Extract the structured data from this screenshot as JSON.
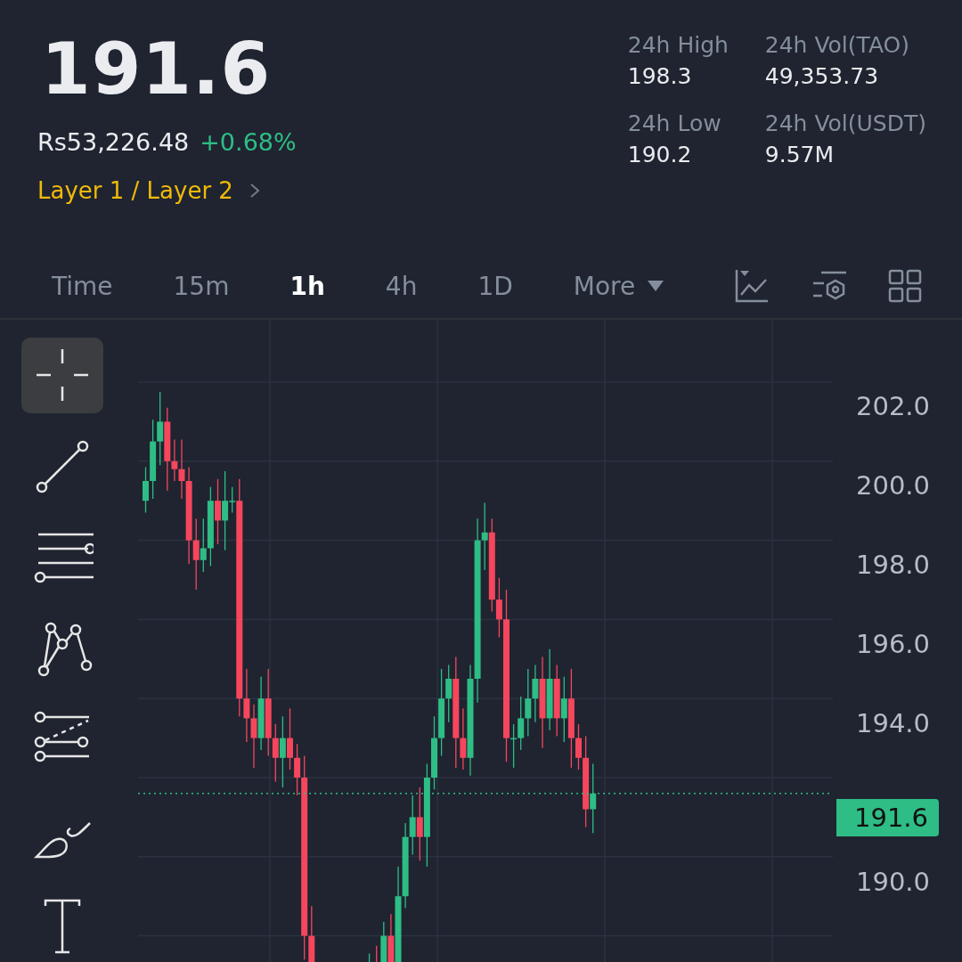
{
  "ticker": {
    "last_price": "191.6",
    "fiat_price": "Rs53,226.48",
    "change": "+0.68%",
    "category": "Layer 1 / Layer 2"
  },
  "stats": [
    {
      "label": "24h High",
      "value": "198.3"
    },
    {
      "label": "24h Vol(TAO)",
      "value": "49,353.73"
    },
    {
      "label": "24h Low",
      "value": "190.2"
    },
    {
      "label": "24h Vol(USDT)",
      "value": "9.57M"
    }
  ],
  "intervals": [
    {
      "label": "Time",
      "selected": false
    },
    {
      "label": "15m",
      "selected": false
    },
    {
      "label": "1h",
      "selected": true
    },
    {
      "label": "4h",
      "selected": false
    },
    {
      "label": "1D",
      "selected": false
    },
    {
      "label": "More",
      "selected": false,
      "dropdown": true
    }
  ],
  "toolbar_icons": [
    {
      "kind": "indicators"
    },
    {
      "kind": "settings"
    },
    {
      "kind": "layout"
    }
  ],
  "drawing_tools": [
    {
      "kind": "crosshair",
      "selected": true
    },
    {
      "kind": "trend-line",
      "selected": false
    },
    {
      "kind": "horizontal-lines",
      "selected": false
    },
    {
      "kind": "pattern",
      "selected": false
    },
    {
      "kind": "channel",
      "selected": false
    },
    {
      "kind": "brush",
      "selected": false
    },
    {
      "kind": "text",
      "selected": false
    }
  ],
  "price_axis": [
    {
      "kind": "tick",
      "label": "202.0"
    },
    {
      "kind": "tick",
      "label": "200.0"
    },
    {
      "kind": "tick",
      "label": "198.0"
    },
    {
      "kind": "tick",
      "label": "196.0"
    },
    {
      "kind": "tick",
      "label": "194.0"
    },
    {
      "kind": "current",
      "label": "191.6"
    },
    {
      "kind": "tick",
      "label": "190.0"
    }
  ]
}
